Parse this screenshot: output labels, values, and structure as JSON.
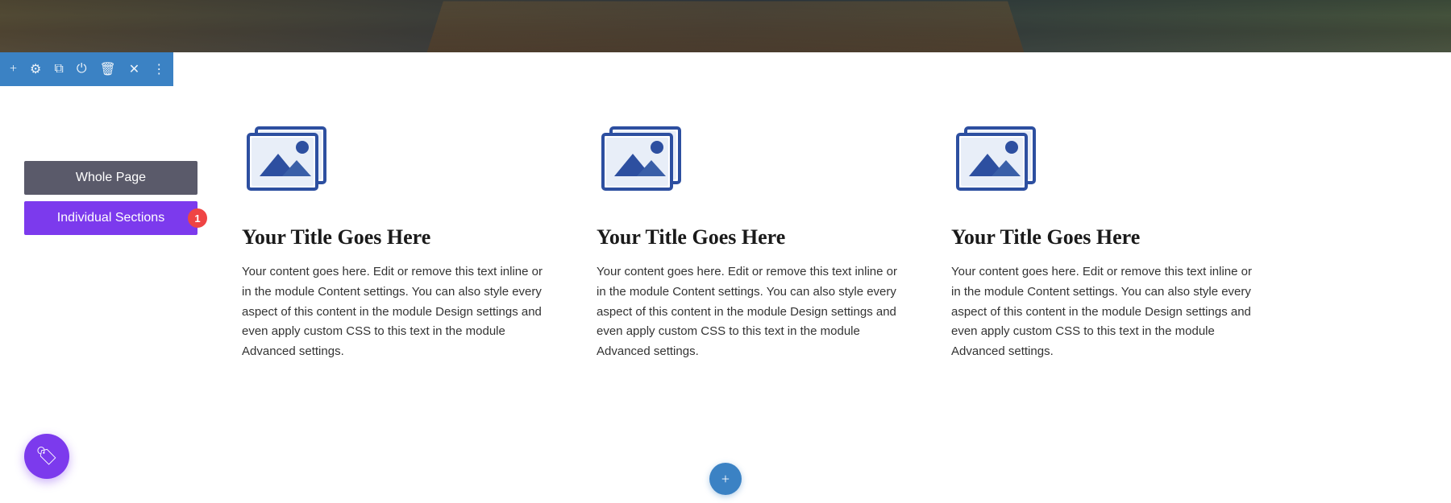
{
  "topBanner": {
    "altText": "Nature landscape with wooden dock"
  },
  "toolbar": {
    "buttons": [
      {
        "name": "add",
        "symbol": "+"
      },
      {
        "name": "settings",
        "symbol": "⚙"
      },
      {
        "name": "duplicate",
        "symbol": "⧉"
      },
      {
        "name": "power",
        "symbol": "⏻"
      },
      {
        "name": "delete",
        "symbol": "🗑"
      },
      {
        "name": "close",
        "symbol": "✕"
      },
      {
        "name": "more",
        "symbol": "⋮"
      }
    ]
  },
  "sidebar": {
    "wholePage": "Whole Page",
    "individualSections": "Individual Sections",
    "badge": "1"
  },
  "fab": {
    "icon": "🏷",
    "bottomCenter": "+"
  },
  "columns": [
    {
      "title": "Your Title Goes Here",
      "text": "Your content goes here. Edit or remove this text inline or in the module Content settings. You can also style every aspect of this content in the module Design settings and even apply custom CSS to this text in the module Advanced settings."
    },
    {
      "title": "Your Title Goes Here",
      "text": "Your content goes here. Edit or remove this text inline or in the module Content settings. You can also style every aspect of this content in the module Design settings and even apply custom CSS to this text in the module Advanced settings."
    },
    {
      "title": "Your Title Goes Here",
      "text": "Your content goes here. Edit or remove this text inline or in the module Content settings. You can also style every aspect of this content in the module Design settings and even apply custom CSS to this text in the module Advanced settings."
    }
  ],
  "colors": {
    "accent": "#3b82c4",
    "purple": "#7c3aed",
    "dark": "#5a5a6a",
    "icon": "#2d4fa0"
  }
}
